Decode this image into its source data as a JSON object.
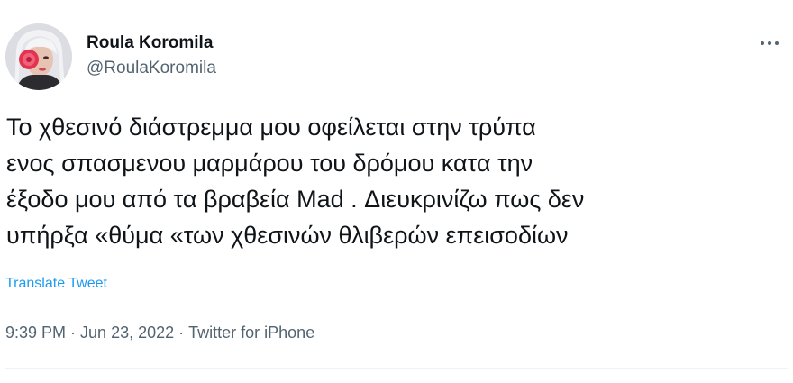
{
  "author": {
    "display_name": "Roula Koromila",
    "handle": "@RoulaKoromila"
  },
  "tweet": {
    "lines": [
      "Το χθεσινό διάστρεμμα μου οφείλεται στην τρύπα",
      "ενος σπασμενου μαρμάρου του δρόμου κατα την",
      "έξοδο μου από τα βραβεία Mad . Διευκρινίζω πως δεν",
      "υπήρξα «θύμα «των χθεσινών θλιβερών επεισοδίων"
    ],
    "translate_label": "Translate Tweet"
  },
  "meta": {
    "time": "9:39 PM",
    "date": "Jun 23, 2022",
    "source": "Twitter for iPhone",
    "separator": "·"
  },
  "icons": {
    "more": "more-horizontal-icon",
    "avatar": "avatar"
  },
  "colors": {
    "text_primary": "#0f1419",
    "text_secondary": "#536471",
    "link": "#1d9bf0",
    "divider": "#eff3f4"
  }
}
